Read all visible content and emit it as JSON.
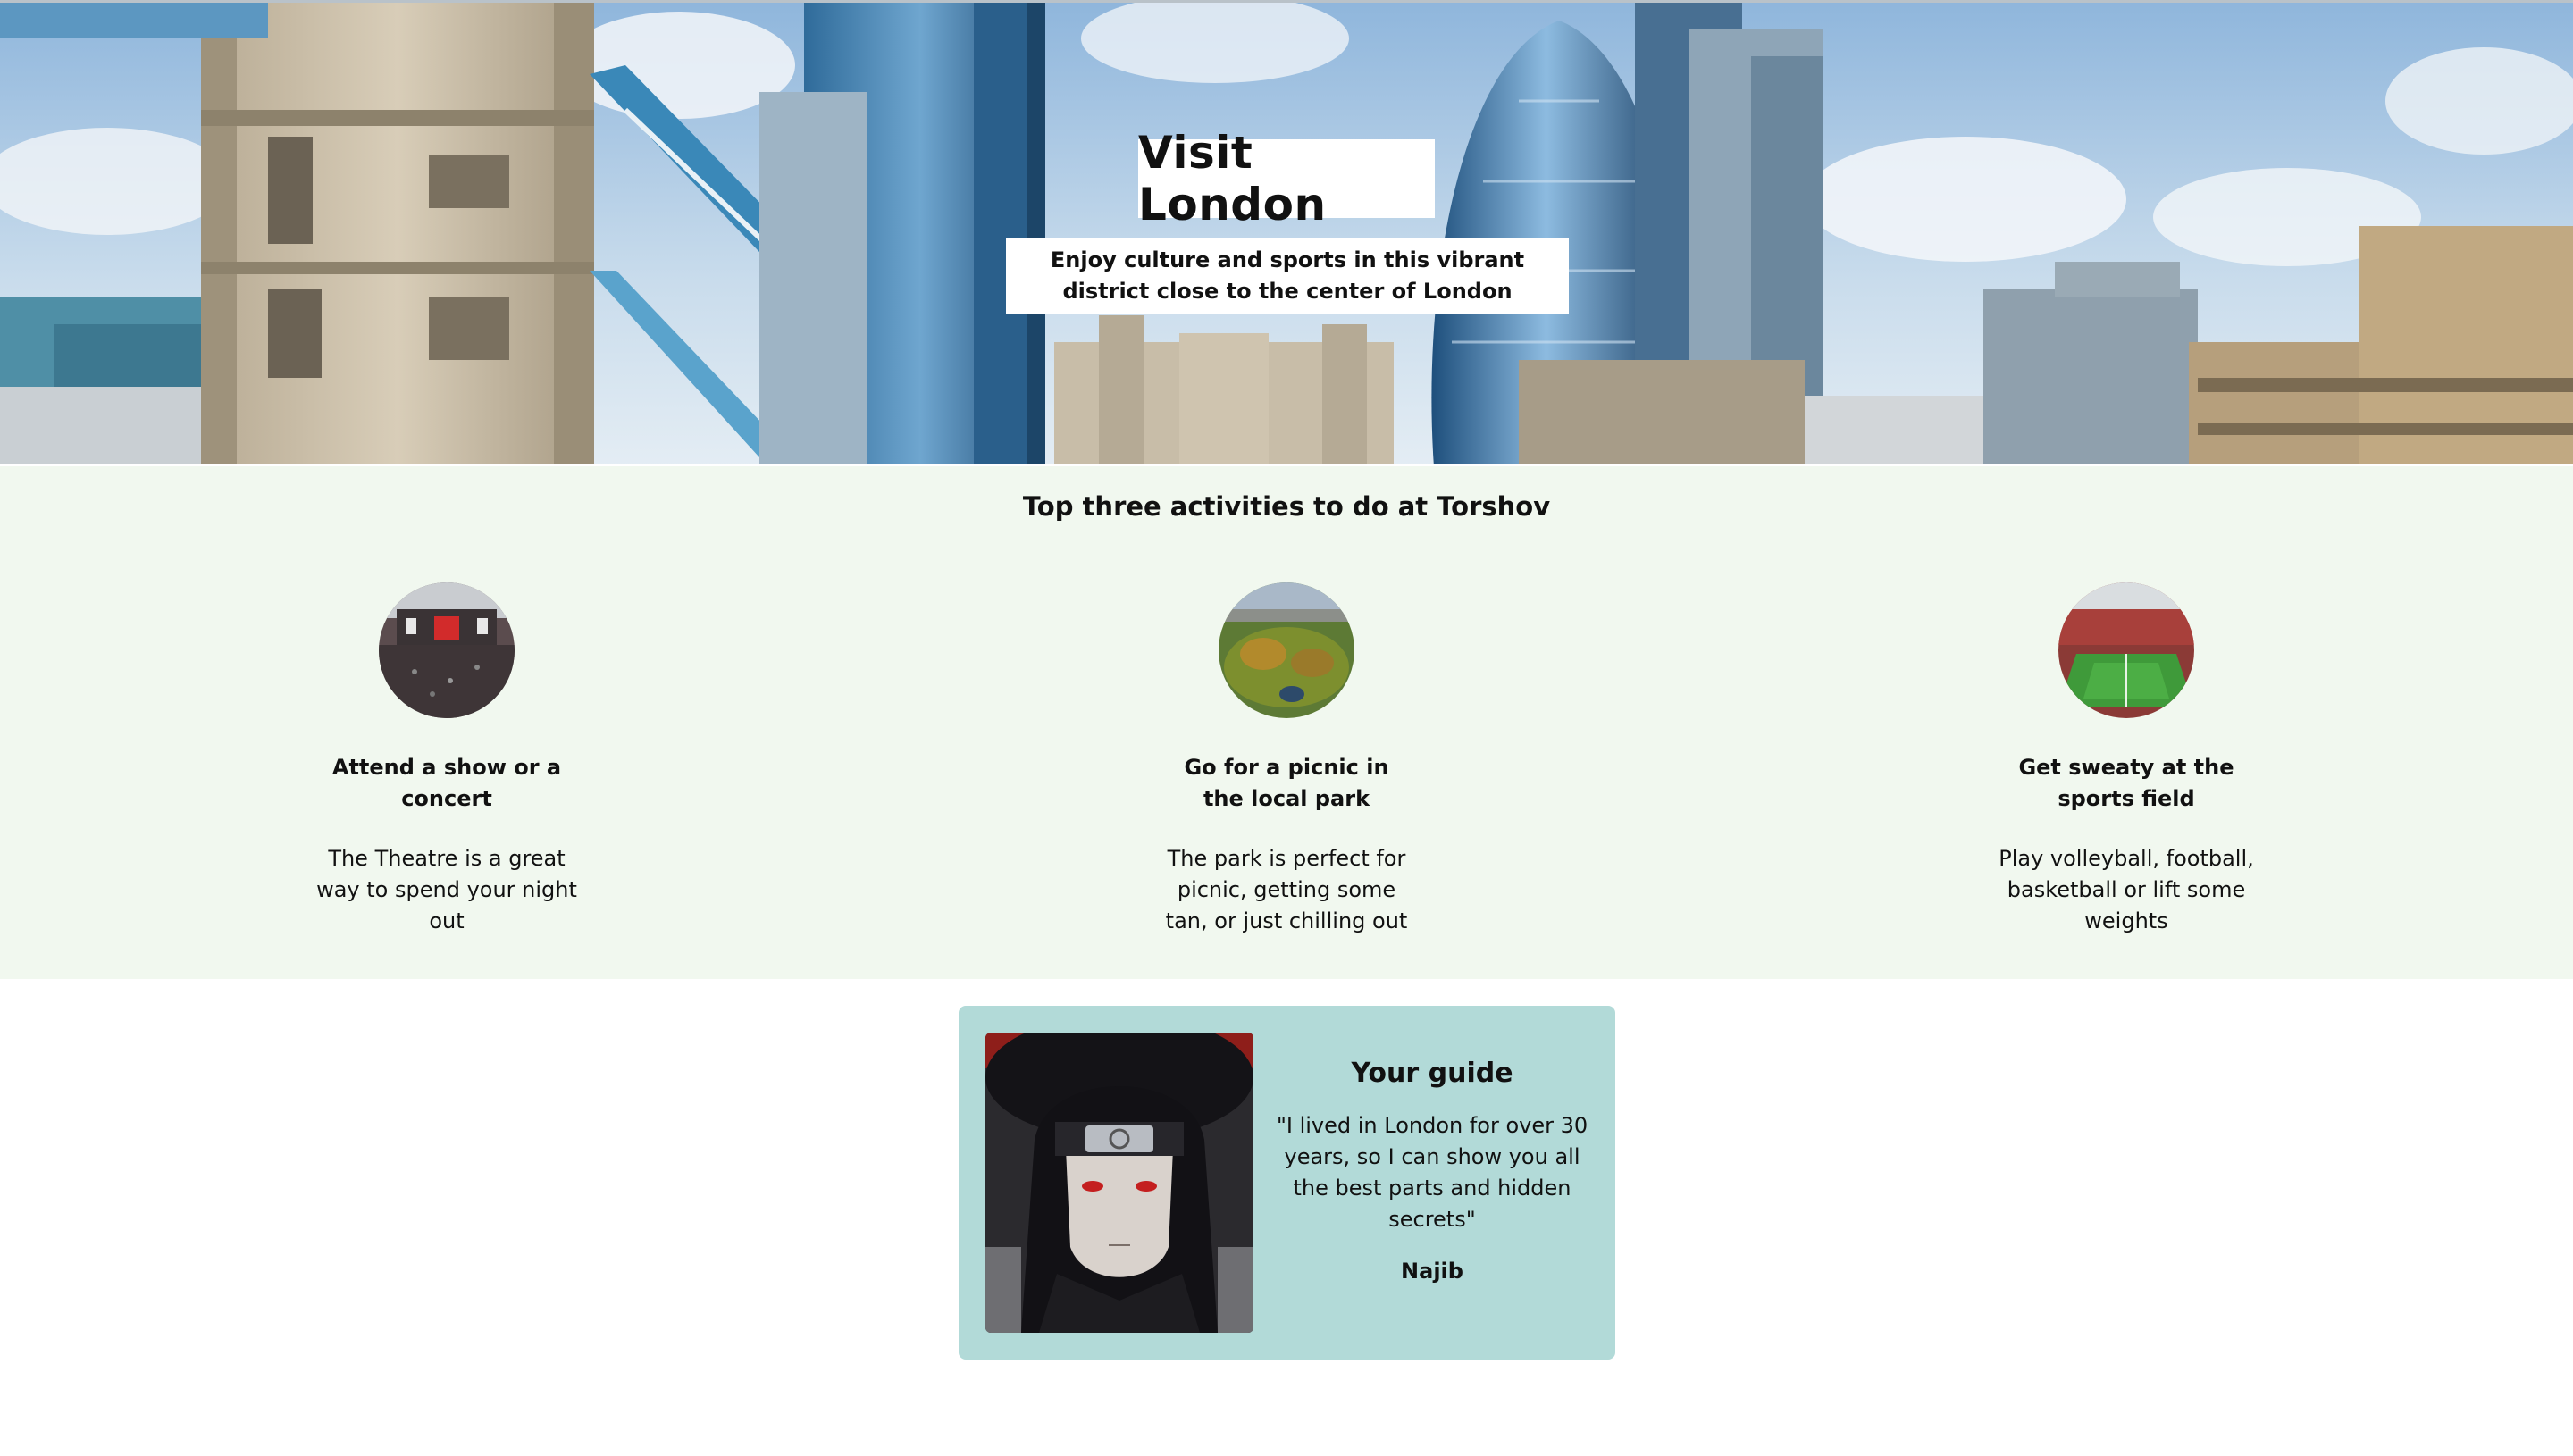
{
  "hero": {
    "title": "Visit London",
    "subtitle": "Enjoy culture and sports in this vibrant district close to the center of London",
    "image_icon": "london-skyline-image"
  },
  "activities": {
    "heading": "Top three activities to do at Torshov",
    "items": [
      {
        "image_icon": "concert-crowd-image",
        "title": "Attend a show or a concert",
        "description": "The Theatre is a great way to spend your night out"
      },
      {
        "image_icon": "park-aerial-image",
        "title": "Go for a picnic in the local park",
        "description": "The park is perfect for picnic, getting some tan, or just chilling out"
      },
      {
        "image_icon": "stadium-image",
        "title": "Get sweaty at the sports field",
        "description": "Play volleyball, football, basketball or lift some weights"
      }
    ]
  },
  "guide": {
    "title": "Your guide",
    "quote": "\"I lived in London for over 30 years, so I can show you all the best parts and hidden secrets\"",
    "name": "Najib",
    "image_icon": "guide-portrait-image"
  },
  "colors": {
    "activities_bg": "#f1f8ef",
    "guide_card_bg": "#b2dad8",
    "text": "#111111"
  }
}
